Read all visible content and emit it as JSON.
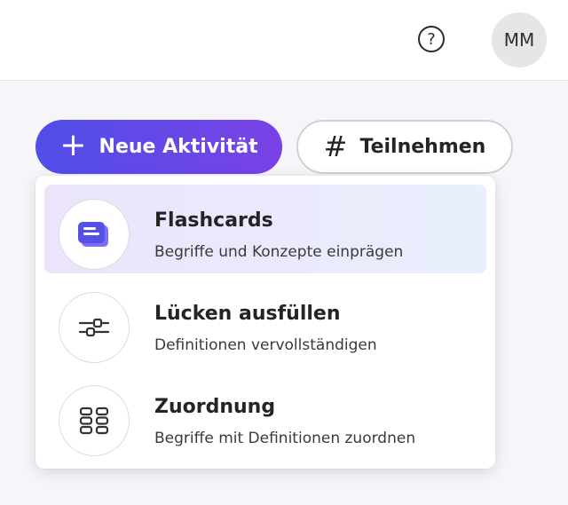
{
  "header": {
    "help_icon": "question-circle-icon",
    "avatar_initials": "MM"
  },
  "actions": {
    "new_activity_label": "Neue Aktivität",
    "join_label": "Teilnehmen"
  },
  "menu": {
    "items": [
      {
        "title": "Flashcards",
        "subtitle": "Begriffe und Konzepte einprägen",
        "icon": "flashcards-icon",
        "highlighted": true
      },
      {
        "title": "Lücken ausfüllen",
        "subtitle": "Definitionen vervollständigen",
        "icon": "fill-blanks-icon",
        "highlighted": false
      },
      {
        "title": "Zuordnung",
        "subtitle": "Begriffe mit Definitionen zuordnen",
        "icon": "matching-icon",
        "highlighted": false
      }
    ]
  },
  "colors": {
    "primary_gradient_start": "#4f4ee8",
    "primary_gradient_end": "#7a42e6",
    "highlight_bg": "#ebe4fb"
  }
}
